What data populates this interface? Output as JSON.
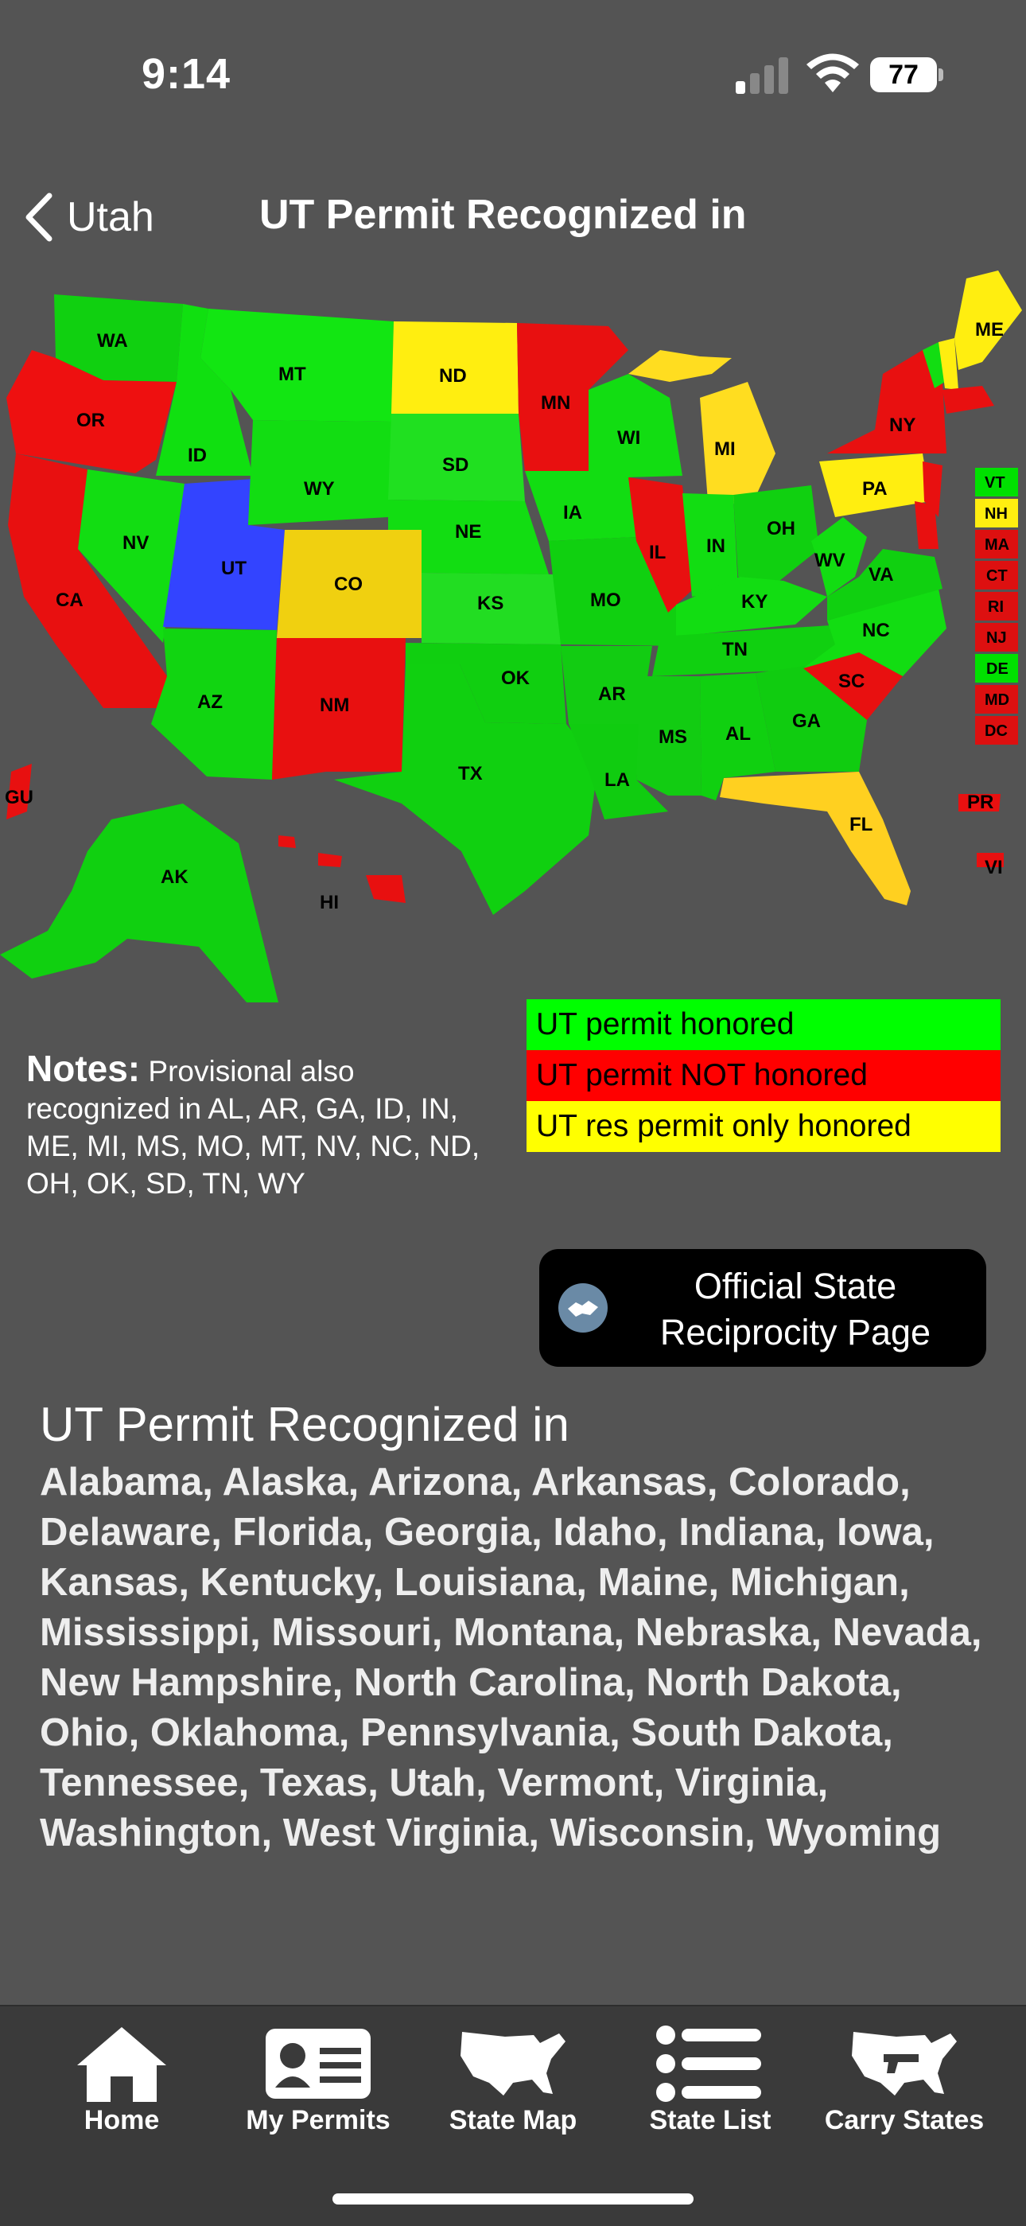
{
  "status": {
    "time": "9:14",
    "battery": "77"
  },
  "nav": {
    "back_label": "Utah",
    "title": "UT Permit Recognized in"
  },
  "map": {
    "labels": {
      "WA": "WA",
      "OR": "OR",
      "CA": "CA",
      "ID": "ID",
      "NV": "NV",
      "UT": "UT",
      "AZ": "AZ",
      "MT": "MT",
      "WY": "WY",
      "CO": "CO",
      "NM": "NM",
      "ND": "ND",
      "SD": "SD",
      "NE": "NE",
      "KS": "KS",
      "OK": "OK",
      "TX": "TX",
      "MN": "MN",
      "IA": "IA",
      "MO": "MO",
      "AR": "AR",
      "LA": "LA",
      "WI": "WI",
      "IL": "IL",
      "MI": "MI",
      "IN": "IN",
      "OH": "OH",
      "KY": "KY",
      "TN": "TN",
      "MS": "MS",
      "AL": "AL",
      "GA": "GA",
      "FL": "FL",
      "SC": "SC",
      "NC": "NC",
      "VA": "VA",
      "WV": "WV",
      "PA": "PA",
      "NY": "NY",
      "ME": "ME",
      "AK": "AK",
      "HI": "HI",
      "GU": "GU",
      "PR": "PR",
      "VI": "VI",
      "VT": "VT",
      "NH": "NH",
      "MA": "MA",
      "CT": "CT",
      "RI": "RI",
      "NJ": "NJ",
      "DE": "DE",
      "MD": "MD",
      "DC": "DC"
    },
    "colors": {
      "honored": "#00ee00",
      "not_honored": "#ee0000",
      "res_only": "#ffee00",
      "home": "#3344ff"
    }
  },
  "legend": [
    {
      "label": "UT permit honored",
      "color": "#00ff00"
    },
    {
      "label": "UT permit NOT honored",
      "color": "#ff0000"
    },
    {
      "label": "UT res permit only honored",
      "color": "#ffff00"
    }
  ],
  "notes": {
    "heading": "Notes:",
    "text": "Provisional also recognized in AL, AR, GA, ID, IN, ME, MI, MS, MO, MT, NV, NC, ND, OH, OK, SD, TN, WY"
  },
  "official_button": {
    "line1": "Official State",
    "line2": "Reciprocity Page"
  },
  "list": {
    "title": "UT Permit Recognized in",
    "states": "Alabama, Alaska, Arizona, Arkansas, Colorado, Delaware, Florida, Georgia, Idaho, Indiana, Iowa, Kansas, Kentucky, Louisiana, Maine, Michigan, Mississippi, Missouri, Montana, Nebraska, Nevada, New Hampshire, North Carolina, North Dakota, Ohio, Oklahoma, Pennsylvania, South Dakota, Tennessee, Texas, Utah, Vermont, Virginia, Washington, West Virginia, Wisconsin, Wyoming"
  },
  "tabs": [
    {
      "label": "Home",
      "icon": "home-icon"
    },
    {
      "label": "My Permits",
      "icon": "id-card-icon"
    },
    {
      "label": "State Map",
      "icon": "us-map-icon"
    },
    {
      "label": "State List",
      "icon": "list-icon"
    },
    {
      "label": "Carry States",
      "icon": "carry-states-icon"
    }
  ]
}
